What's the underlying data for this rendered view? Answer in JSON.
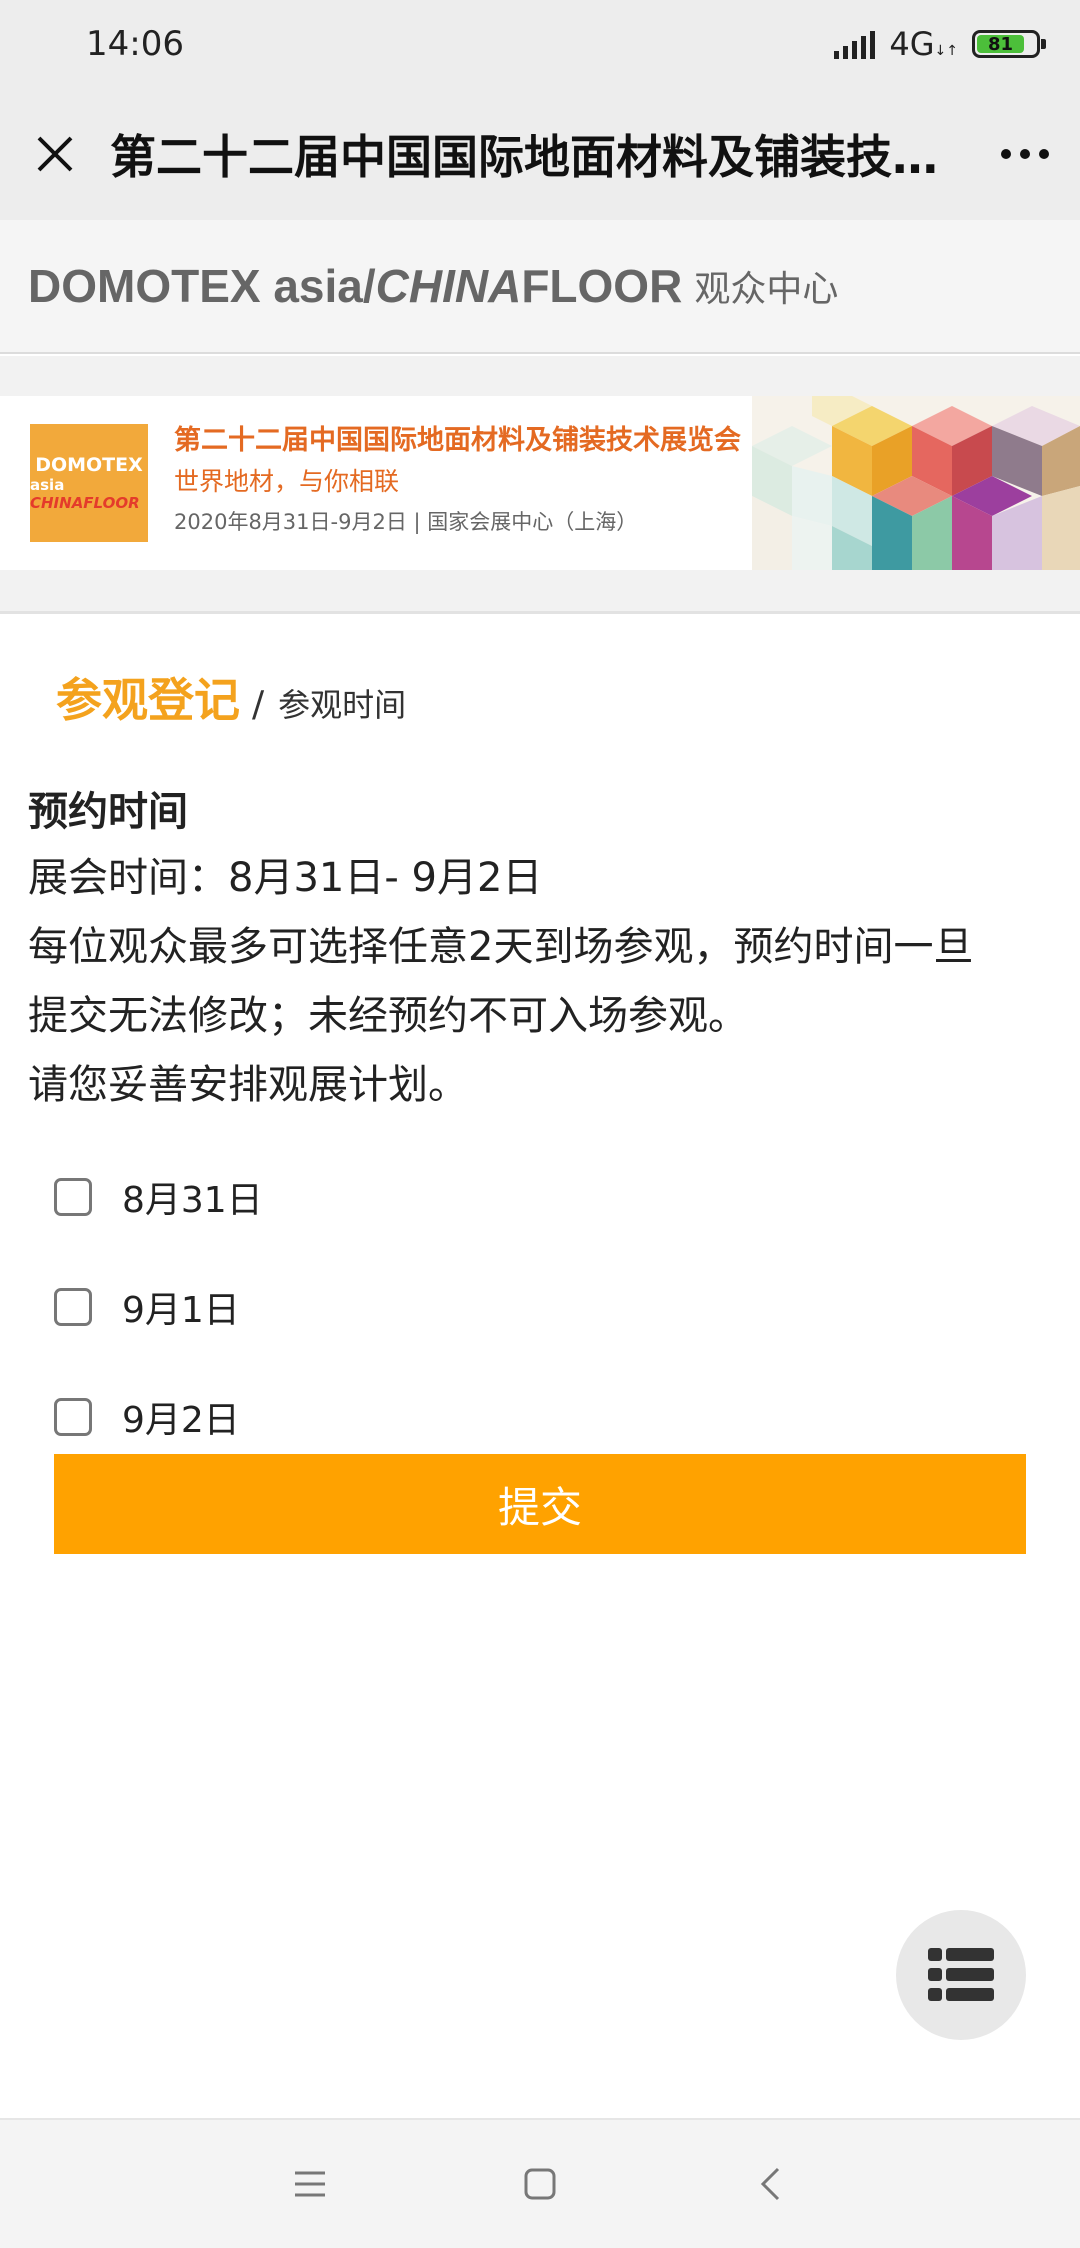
{
  "status_bar": {
    "time": "14:06",
    "network": "4G",
    "battery": "81",
    "battery_level": 0.81
  },
  "title_bar": {
    "title": "第二十二届中国国际地面材料及铺装技…"
  },
  "header": {
    "brand_part1": "DOMOTEX asia/",
    "brand_italic": "CHINA",
    "brand_part2": "FLOOR",
    "subtitle": "观众中心"
  },
  "banner": {
    "logo_line1": "DOMOTEX",
    "logo_line2_a": "asia",
    "logo_line2_b": "CHINAFLOOR",
    "title": "第二十二届中国国际地面材料及铺装技术展览会",
    "slogan": "世界地材，与你相联",
    "date_venue": "2020年8月31日-9月2日 | 国家会展中心（上海）"
  },
  "breadcrumb": {
    "main": "参观登记",
    "separator": "/",
    "sub": "参观时间"
  },
  "content": {
    "section_title": "预约时间",
    "exhibition_time": "展会时间：8月31日- 9月2日",
    "note_line1": "每位观众最多可选择任意2天到场参观，预约时间一旦",
    "note_line2": "提交无法修改；未经预约不可入场参观。",
    "note_line3": "请您妥善安排观展计划。"
  },
  "options": [
    "8月31日",
    "9月1日",
    "9月2日"
  ],
  "submit_label": "提交",
  "colors": {
    "accent": "#ffa200",
    "breadcrumb": "#f4a21d",
    "banner_text": "#e46a22"
  },
  "icons": {
    "close": "close-icon",
    "more": "more-dots-icon",
    "fab": "list-icon",
    "nav": [
      "menu-icon",
      "home-square-icon",
      "back-chevron-icon"
    ]
  }
}
